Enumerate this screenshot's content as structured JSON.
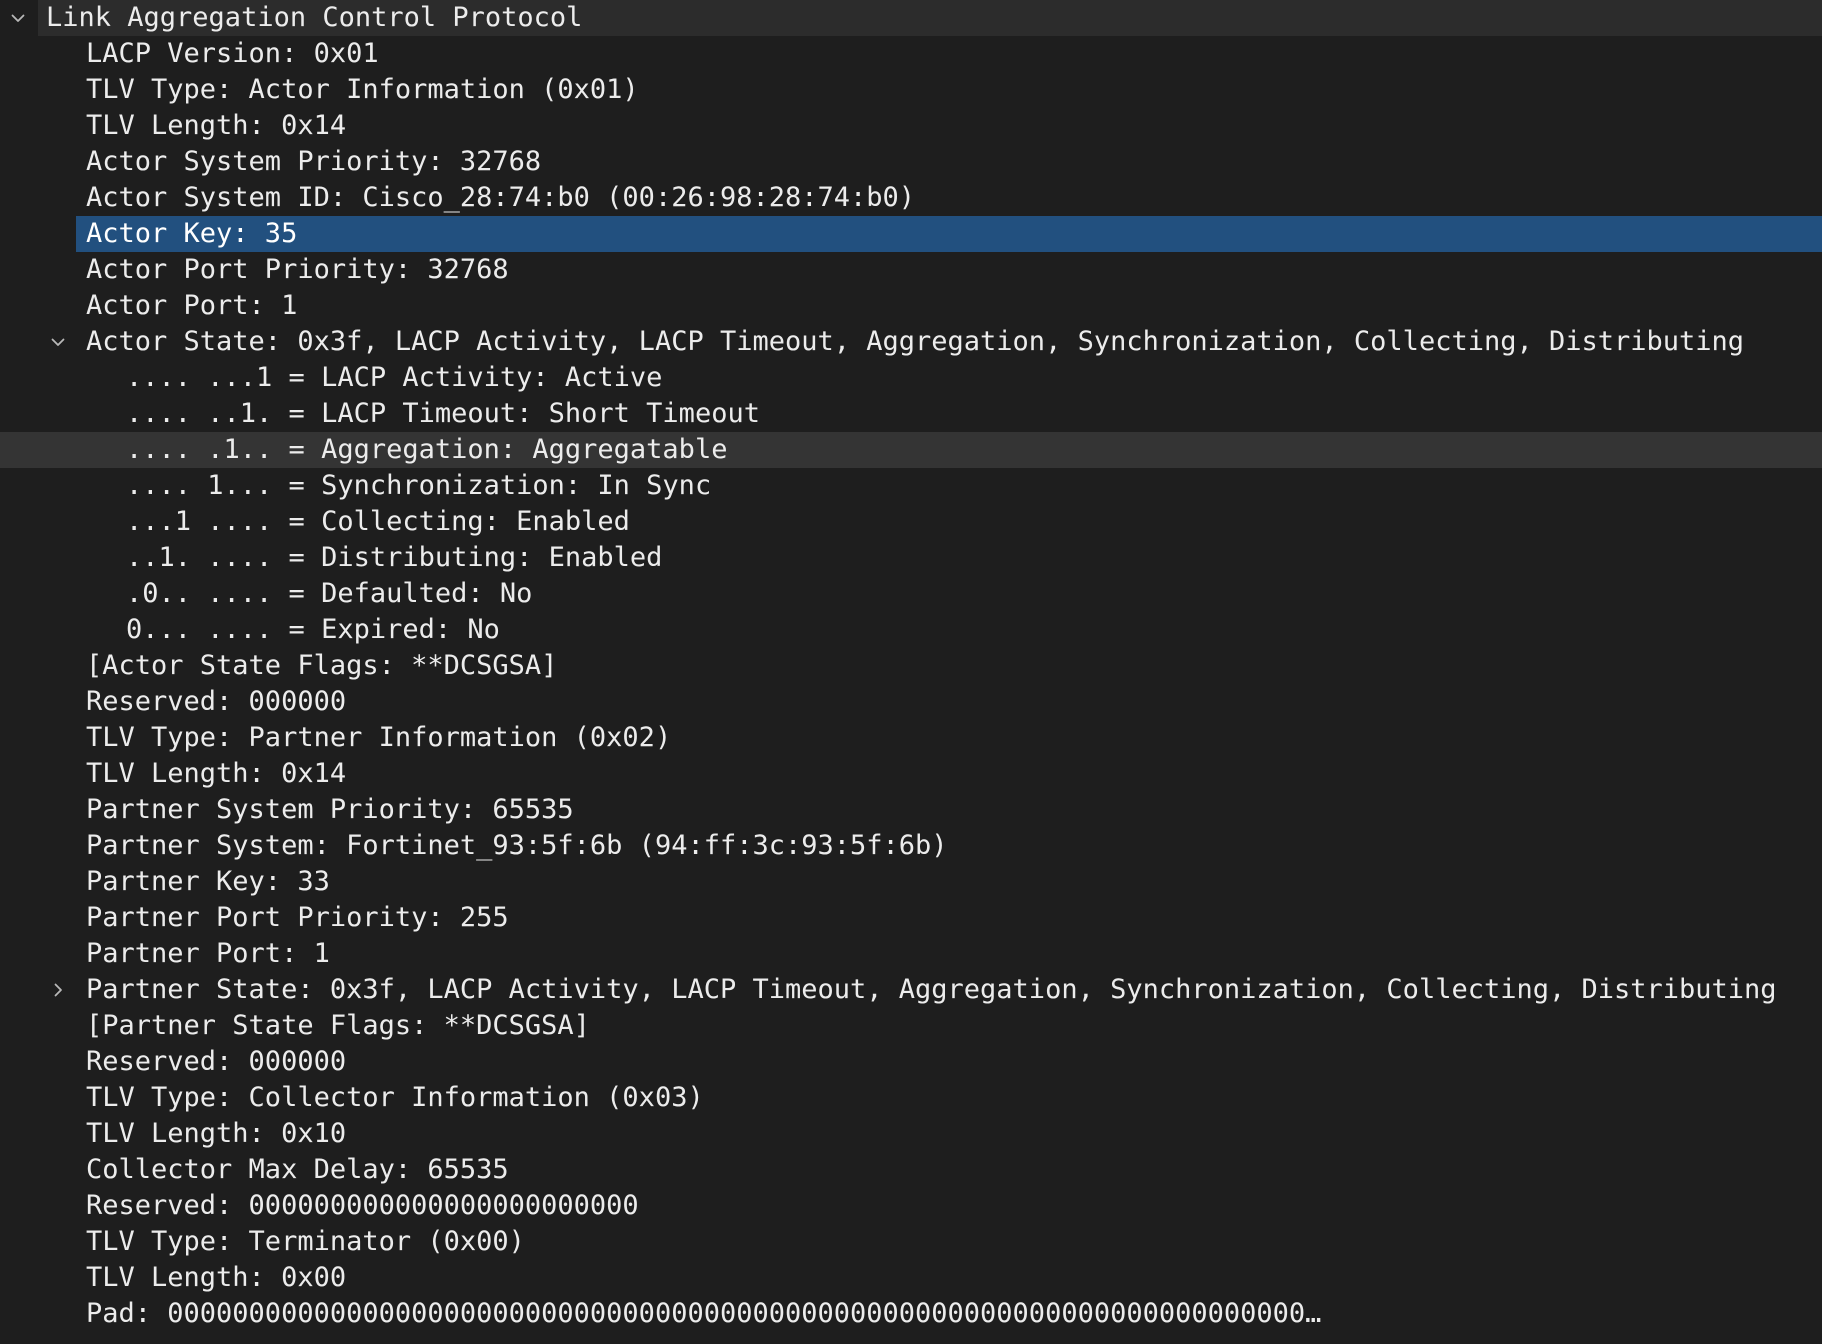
{
  "tree": {
    "rows": [
      {
        "level": 0,
        "toggle": "expanded",
        "toggle_icon": "chevron-down-icon",
        "text": "Link Aggregation Control Protocol",
        "state": "header"
      },
      {
        "level": 1,
        "text": "LACP Version: 0x01"
      },
      {
        "level": 1,
        "text": "TLV Type: Actor Information (0x01)"
      },
      {
        "level": 1,
        "text": "TLV Length: 0x14"
      },
      {
        "level": 1,
        "text": "Actor System Priority: 32768"
      },
      {
        "level": 1,
        "text": "Actor System ID: Cisco_28:74:b0 (00:26:98:28:74:b0)"
      },
      {
        "level": 1,
        "text": "Actor Key: 35",
        "state": "selected"
      },
      {
        "level": 1,
        "text": "Actor Port Priority: 32768"
      },
      {
        "level": 1,
        "text": "Actor Port: 1"
      },
      {
        "level": 1,
        "toggle": "expanded",
        "toggle_icon": "chevron-down-icon",
        "text": "Actor State: 0x3f, LACP Activity, LACP Timeout, Aggregation, Synchronization, Collecting, Distributing"
      },
      {
        "level": 2,
        "text": ".... ...1 = LACP Activity: Active"
      },
      {
        "level": 2,
        "text": ".... ..1. = LACP Timeout: Short Timeout"
      },
      {
        "level": 2,
        "text": ".... .1.. = Aggregation: Aggregatable",
        "state": "hover"
      },
      {
        "level": 2,
        "text": ".... 1... = Synchronization: In Sync"
      },
      {
        "level": 2,
        "text": "...1 .... = Collecting: Enabled"
      },
      {
        "level": 2,
        "text": "..1. .... = Distributing: Enabled"
      },
      {
        "level": 2,
        "text": ".0.. .... = Defaulted: No"
      },
      {
        "level": 2,
        "text": "0... .... = Expired: No"
      },
      {
        "level": 1,
        "text": "[Actor State Flags: **DCSGSA]"
      },
      {
        "level": 1,
        "text": "Reserved: 000000"
      },
      {
        "level": 1,
        "text": "TLV Type: Partner Information (0x02)"
      },
      {
        "level": 1,
        "text": "TLV Length: 0x14"
      },
      {
        "level": 1,
        "text": "Partner System Priority: 65535"
      },
      {
        "level": 1,
        "text": "Partner System: Fortinet_93:5f:6b (94:ff:3c:93:5f:6b)"
      },
      {
        "level": 1,
        "text": "Partner Key: 33"
      },
      {
        "level": 1,
        "text": "Partner Port Priority: 255"
      },
      {
        "level": 1,
        "text": "Partner Port: 1"
      },
      {
        "level": 1,
        "toggle": "collapsed",
        "toggle_icon": "chevron-right-icon",
        "text": "Partner State: 0x3f, LACP Activity, LACP Timeout, Aggregation, Synchronization, Collecting, Distributing"
      },
      {
        "level": 1,
        "text": "[Partner State Flags: **DCSGSA]"
      },
      {
        "level": 1,
        "text": "Reserved: 000000"
      },
      {
        "level": 1,
        "text": "TLV Type: Collector Information (0x03)"
      },
      {
        "level": 1,
        "text": "TLV Length: 0x10"
      },
      {
        "level": 1,
        "text": "Collector Max Delay: 65535"
      },
      {
        "level": 1,
        "text": "Reserved: 000000000000000000000000"
      },
      {
        "level": 1,
        "text": "TLV Type: Terminator (0x00)"
      },
      {
        "level": 1,
        "text": "TLV Length: 0x00"
      },
      {
        "level": 1,
        "text": "Pad: 0000000000000000000000000000000000000000000000000000000000000000000000…"
      }
    ]
  },
  "colors": {
    "background": "#1e1e1e",
    "text": "#ececec",
    "selected_row": "#22507f",
    "hover_row": "#343434",
    "header_row": "#2c2c2c",
    "twisty": "#b8b8b8"
  }
}
